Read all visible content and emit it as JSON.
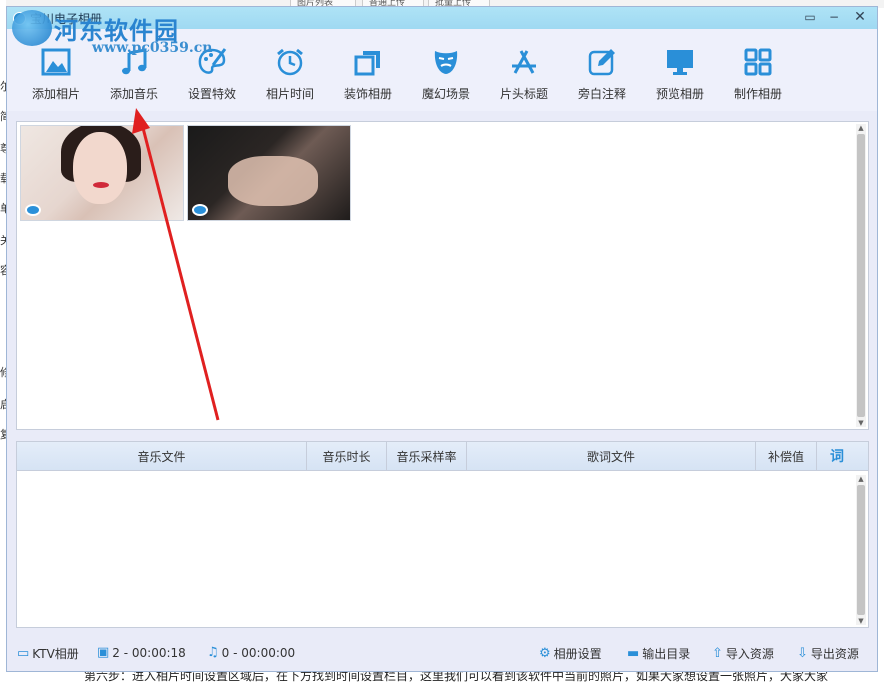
{
  "background": {
    "tabs": [
      "图片列表",
      "普通上传",
      "批量上传"
    ],
    "left_glyphs": [
      "尔",
      "简",
      "尊",
      "载",
      "单",
      "关",
      "容",
      "修",
      "启",
      "复"
    ],
    "footer_text": "第六步：进入相片时间设置区域后，在下方找到时间设置栏目，这里我们可以看到该软件中当前的照片，如果大家想设置一张照片，大家大家"
  },
  "window": {
    "title": "宝川电子相册",
    "controls": {
      "restore": "▭",
      "minimize": "−",
      "close": "✕"
    }
  },
  "watermark": {
    "name": "河东软件园",
    "url": "www.pc0359.cn"
  },
  "toolbar": {
    "items": [
      {
        "label": "添加相片",
        "icon": "image-frame-icon"
      },
      {
        "label": "添加音乐",
        "icon": "music-note-icon"
      },
      {
        "label": "设置特效",
        "icon": "palette-icon"
      },
      {
        "label": "相片时间",
        "icon": "alarm-clock-icon"
      },
      {
        "label": "装饰相册",
        "icon": "layers-icon"
      },
      {
        "label": "魔幻场景",
        "icon": "theater-mask-icon"
      },
      {
        "label": "片头标题",
        "icon": "app-store-icon"
      },
      {
        "label": "旁白注释",
        "icon": "edit-note-icon"
      },
      {
        "label": "预览相册",
        "icon": "monitor-icon"
      },
      {
        "label": "制作相册",
        "icon": "grid-apps-icon"
      }
    ]
  },
  "photos": [
    {
      "name": "photo-1",
      "preview_icon": "eye-icon"
    },
    {
      "name": "photo-2",
      "preview_icon": "eye-icon"
    }
  ],
  "music_table": {
    "columns": [
      "音乐文件",
      "音乐时长",
      "音乐采样率",
      "歌词文件",
      "补偿值",
      "词"
    ],
    "rows": []
  },
  "statusbar": {
    "ktv_label": "KTV相册",
    "photo_count": "2 - 00:00:18",
    "music_count": "0 - 00:00:00",
    "album_settings": "相册设置",
    "output_dir": "输出目录",
    "import_resources": "导入资源",
    "export_resources": "导出资源"
  },
  "colors": {
    "accent": "#2a8fd8",
    "titlebar": "#a6dcf4",
    "window_bg": "#e9ebf8",
    "annotation_arrow": "#e02020"
  }
}
